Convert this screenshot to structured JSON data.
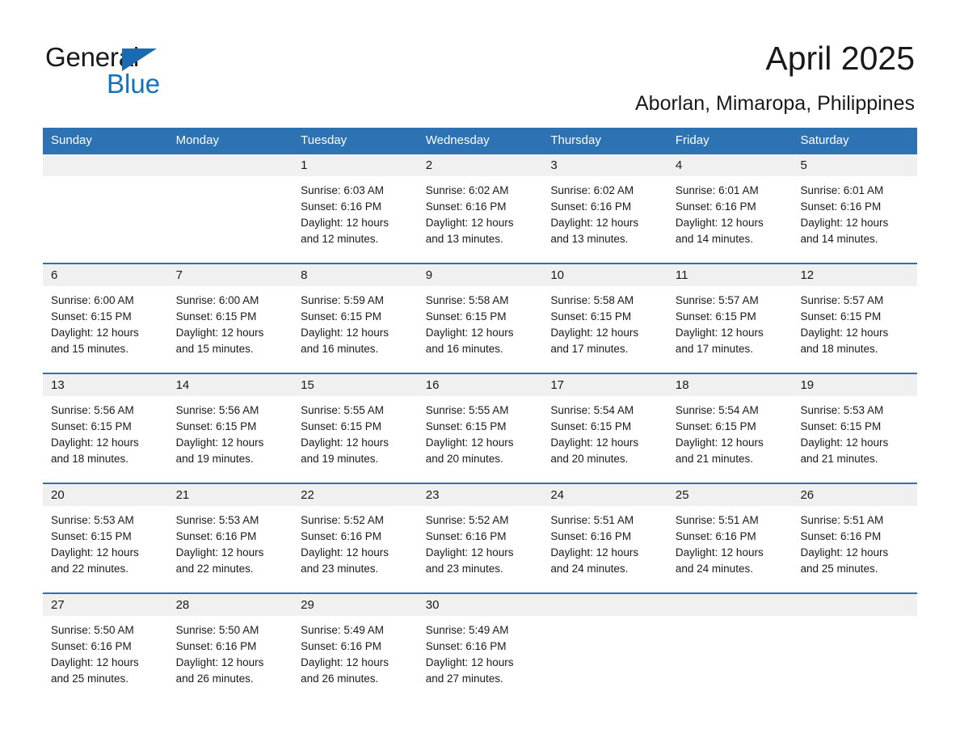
{
  "brand": {
    "name_part1": "General",
    "name_part2": "Blue",
    "triangle_icon": "brand-triangle-icon",
    "color_black": "#1a1a1a",
    "color_blue": "#1272ba"
  },
  "header": {
    "title": "April 2025",
    "subtitle": "Aborlan, Mimaropa, Philippines"
  },
  "theme": {
    "header_bg": "#2d72b3",
    "header_text": "#ffffff",
    "daynum_bg": "#f0f0f0",
    "cell_bg": "#ffffff",
    "text": "#1a1a1a"
  },
  "calendar": {
    "weekdays": [
      "Sunday",
      "Monday",
      "Tuesday",
      "Wednesday",
      "Thursday",
      "Friday",
      "Saturday"
    ],
    "weeks": [
      {
        "days": [
          {
            "num": "",
            "sunrise": "",
            "sunset": "",
            "daylight_line1": "",
            "daylight_line2": ""
          },
          {
            "num": "",
            "sunrise": "",
            "sunset": "",
            "daylight_line1": "",
            "daylight_line2": ""
          },
          {
            "num": "1",
            "sunrise": "Sunrise: 6:03 AM",
            "sunset": "Sunset: 6:16 PM",
            "daylight_line1": "Daylight: 12 hours",
            "daylight_line2": "and 12 minutes."
          },
          {
            "num": "2",
            "sunrise": "Sunrise: 6:02 AM",
            "sunset": "Sunset: 6:16 PM",
            "daylight_line1": "Daylight: 12 hours",
            "daylight_line2": "and 13 minutes."
          },
          {
            "num": "3",
            "sunrise": "Sunrise: 6:02 AM",
            "sunset": "Sunset: 6:16 PM",
            "daylight_line1": "Daylight: 12 hours",
            "daylight_line2": "and 13 minutes."
          },
          {
            "num": "4",
            "sunrise": "Sunrise: 6:01 AM",
            "sunset": "Sunset: 6:16 PM",
            "daylight_line1": "Daylight: 12 hours",
            "daylight_line2": "and 14 minutes."
          },
          {
            "num": "5",
            "sunrise": "Sunrise: 6:01 AM",
            "sunset": "Sunset: 6:16 PM",
            "daylight_line1": "Daylight: 12 hours",
            "daylight_line2": "and 14 minutes."
          }
        ]
      },
      {
        "days": [
          {
            "num": "6",
            "sunrise": "Sunrise: 6:00 AM",
            "sunset": "Sunset: 6:15 PM",
            "daylight_line1": "Daylight: 12 hours",
            "daylight_line2": "and 15 minutes."
          },
          {
            "num": "7",
            "sunrise": "Sunrise: 6:00 AM",
            "sunset": "Sunset: 6:15 PM",
            "daylight_line1": "Daylight: 12 hours",
            "daylight_line2": "and 15 minutes."
          },
          {
            "num": "8",
            "sunrise": "Sunrise: 5:59 AM",
            "sunset": "Sunset: 6:15 PM",
            "daylight_line1": "Daylight: 12 hours",
            "daylight_line2": "and 16 minutes."
          },
          {
            "num": "9",
            "sunrise": "Sunrise: 5:58 AM",
            "sunset": "Sunset: 6:15 PM",
            "daylight_line1": "Daylight: 12 hours",
            "daylight_line2": "and 16 minutes."
          },
          {
            "num": "10",
            "sunrise": "Sunrise: 5:58 AM",
            "sunset": "Sunset: 6:15 PM",
            "daylight_line1": "Daylight: 12 hours",
            "daylight_line2": "and 17 minutes."
          },
          {
            "num": "11",
            "sunrise": "Sunrise: 5:57 AM",
            "sunset": "Sunset: 6:15 PM",
            "daylight_line1": "Daylight: 12 hours",
            "daylight_line2": "and 17 minutes."
          },
          {
            "num": "12",
            "sunrise": "Sunrise: 5:57 AM",
            "sunset": "Sunset: 6:15 PM",
            "daylight_line1": "Daylight: 12 hours",
            "daylight_line2": "and 18 minutes."
          }
        ]
      },
      {
        "days": [
          {
            "num": "13",
            "sunrise": "Sunrise: 5:56 AM",
            "sunset": "Sunset: 6:15 PM",
            "daylight_line1": "Daylight: 12 hours",
            "daylight_line2": "and 18 minutes."
          },
          {
            "num": "14",
            "sunrise": "Sunrise: 5:56 AM",
            "sunset": "Sunset: 6:15 PM",
            "daylight_line1": "Daylight: 12 hours",
            "daylight_line2": "and 19 minutes."
          },
          {
            "num": "15",
            "sunrise": "Sunrise: 5:55 AM",
            "sunset": "Sunset: 6:15 PM",
            "daylight_line1": "Daylight: 12 hours",
            "daylight_line2": "and 19 minutes."
          },
          {
            "num": "16",
            "sunrise": "Sunrise: 5:55 AM",
            "sunset": "Sunset: 6:15 PM",
            "daylight_line1": "Daylight: 12 hours",
            "daylight_line2": "and 20 minutes."
          },
          {
            "num": "17",
            "sunrise": "Sunrise: 5:54 AM",
            "sunset": "Sunset: 6:15 PM",
            "daylight_line1": "Daylight: 12 hours",
            "daylight_line2": "and 20 minutes."
          },
          {
            "num": "18",
            "sunrise": "Sunrise: 5:54 AM",
            "sunset": "Sunset: 6:15 PM",
            "daylight_line1": "Daylight: 12 hours",
            "daylight_line2": "and 21 minutes."
          },
          {
            "num": "19",
            "sunrise": "Sunrise: 5:53 AM",
            "sunset": "Sunset: 6:15 PM",
            "daylight_line1": "Daylight: 12 hours",
            "daylight_line2": "and 21 minutes."
          }
        ]
      },
      {
        "days": [
          {
            "num": "20",
            "sunrise": "Sunrise: 5:53 AM",
            "sunset": "Sunset: 6:15 PM",
            "daylight_line1": "Daylight: 12 hours",
            "daylight_line2": "and 22 minutes."
          },
          {
            "num": "21",
            "sunrise": "Sunrise: 5:53 AM",
            "sunset": "Sunset: 6:16 PM",
            "daylight_line1": "Daylight: 12 hours",
            "daylight_line2": "and 22 minutes."
          },
          {
            "num": "22",
            "sunrise": "Sunrise: 5:52 AM",
            "sunset": "Sunset: 6:16 PM",
            "daylight_line1": "Daylight: 12 hours",
            "daylight_line2": "and 23 minutes."
          },
          {
            "num": "23",
            "sunrise": "Sunrise: 5:52 AM",
            "sunset": "Sunset: 6:16 PM",
            "daylight_line1": "Daylight: 12 hours",
            "daylight_line2": "and 23 minutes."
          },
          {
            "num": "24",
            "sunrise": "Sunrise: 5:51 AM",
            "sunset": "Sunset: 6:16 PM",
            "daylight_line1": "Daylight: 12 hours",
            "daylight_line2": "and 24 minutes."
          },
          {
            "num": "25",
            "sunrise": "Sunrise: 5:51 AM",
            "sunset": "Sunset: 6:16 PM",
            "daylight_line1": "Daylight: 12 hours",
            "daylight_line2": "and 24 minutes."
          },
          {
            "num": "26",
            "sunrise": "Sunrise: 5:51 AM",
            "sunset": "Sunset: 6:16 PM",
            "daylight_line1": "Daylight: 12 hours",
            "daylight_line2": "and 25 minutes."
          }
        ]
      },
      {
        "days": [
          {
            "num": "27",
            "sunrise": "Sunrise: 5:50 AM",
            "sunset": "Sunset: 6:16 PM",
            "daylight_line1": "Daylight: 12 hours",
            "daylight_line2": "and 25 minutes."
          },
          {
            "num": "28",
            "sunrise": "Sunrise: 5:50 AM",
            "sunset": "Sunset: 6:16 PM",
            "daylight_line1": "Daylight: 12 hours",
            "daylight_line2": "and 26 minutes."
          },
          {
            "num": "29",
            "sunrise": "Sunrise: 5:49 AM",
            "sunset": "Sunset: 6:16 PM",
            "daylight_line1": "Daylight: 12 hours",
            "daylight_line2": "and 26 minutes."
          },
          {
            "num": "30",
            "sunrise": "Sunrise: 5:49 AM",
            "sunset": "Sunset: 6:16 PM",
            "daylight_line1": "Daylight: 12 hours",
            "daylight_line2": "and 27 minutes."
          },
          {
            "num": "",
            "sunrise": "",
            "sunset": "",
            "daylight_line1": "",
            "daylight_line2": ""
          },
          {
            "num": "",
            "sunrise": "",
            "sunset": "",
            "daylight_line1": "",
            "daylight_line2": ""
          },
          {
            "num": "",
            "sunrise": "",
            "sunset": "",
            "daylight_line1": "",
            "daylight_line2": ""
          }
        ]
      }
    ]
  }
}
